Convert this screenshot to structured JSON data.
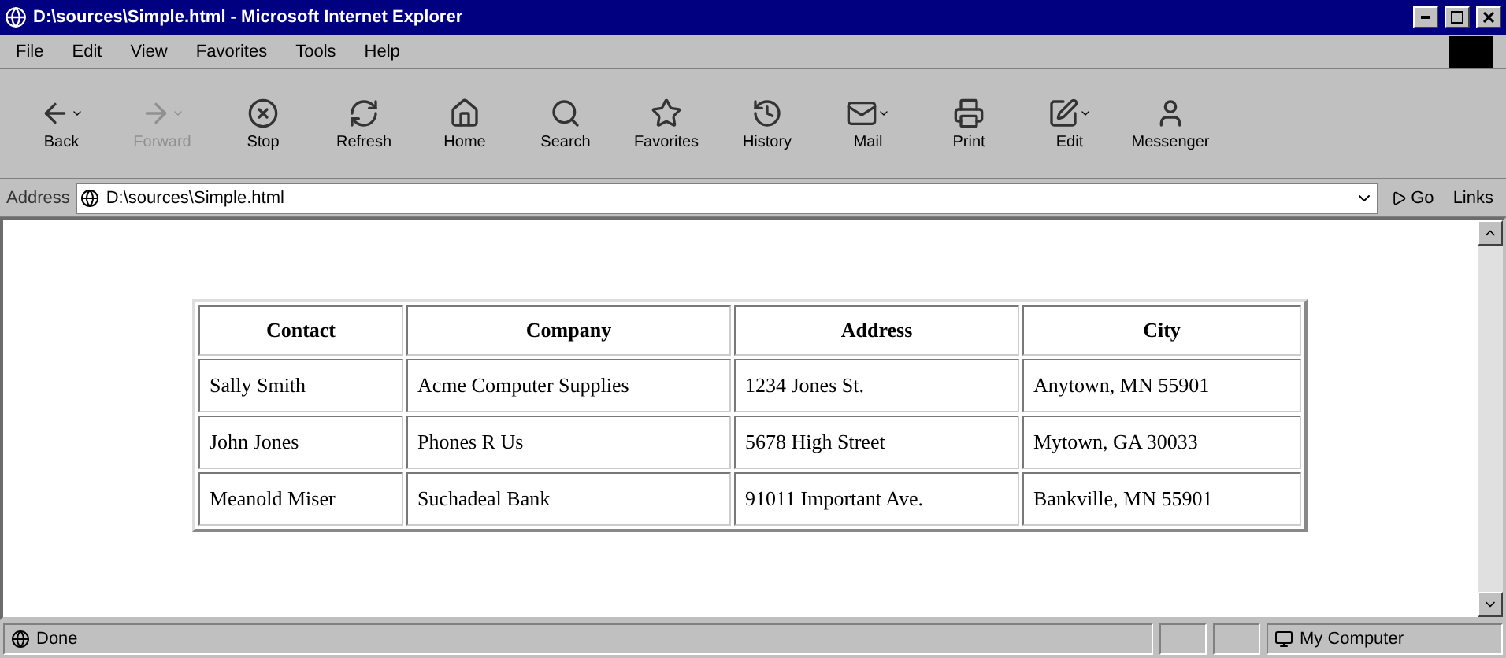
{
  "window": {
    "title": "D:\\sources\\Simple.html - Microsoft Internet Explorer"
  },
  "menu": [
    "File",
    "Edit",
    "View",
    "Favorites",
    "Tools",
    "Help"
  ],
  "toolbar": [
    {
      "kind": "back",
      "label": "Back",
      "disabled": false,
      "dropdown": true
    },
    {
      "kind": "forward",
      "label": "Forward",
      "disabled": true,
      "dropdown": true
    },
    {
      "kind": "stop",
      "label": "Stop",
      "disabled": false,
      "dropdown": false
    },
    {
      "kind": "refresh",
      "label": "Refresh",
      "disabled": false,
      "dropdown": false
    },
    {
      "kind": "home",
      "label": "Home",
      "disabled": false,
      "dropdown": false
    },
    {
      "kind": "search",
      "label": "Search",
      "disabled": false,
      "dropdown": false
    },
    {
      "kind": "favorites",
      "label": "Favorites",
      "disabled": false,
      "dropdown": false
    },
    {
      "kind": "history",
      "label": "History",
      "disabled": false,
      "dropdown": false
    },
    {
      "kind": "mail",
      "label": "Mail",
      "disabled": false,
      "dropdown": true
    },
    {
      "kind": "print",
      "label": "Print",
      "disabled": false,
      "dropdown": false
    },
    {
      "kind": "edit",
      "label": "Edit",
      "disabled": false,
      "dropdown": true
    },
    {
      "kind": "messenger",
      "label": "Messenger",
      "disabled": false,
      "dropdown": false
    }
  ],
  "address_bar": {
    "label": "Address",
    "value": "D:\\sources\\Simple.html",
    "go": "Go",
    "links": "Links"
  },
  "table": {
    "columns": [
      "Contact",
      "Company",
      "Address",
      "City"
    ],
    "rows": [
      [
        "Sally Smith",
        "Acme Computer Supplies",
        "1234 Jones St.",
        "Anytown, MN 55901"
      ],
      [
        "John Jones",
        "Phones R Us",
        "5678 High Street",
        "Mytown, GA 30033"
      ],
      [
        "Meanold Miser",
        "Suchadeal Bank",
        "91011 Important Ave.",
        "Bankville, MN 55901"
      ]
    ]
  },
  "status_bar": {
    "text": "Done",
    "zone": "My Computer"
  }
}
